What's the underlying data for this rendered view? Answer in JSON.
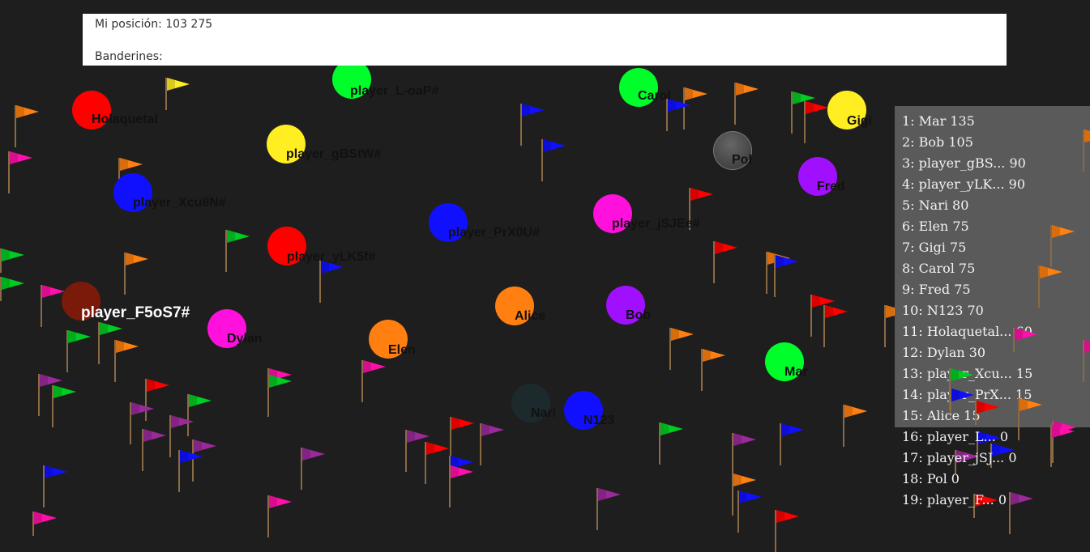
{
  "hud": {
    "position_label": "Mi posición:",
    "position_value": "103 275",
    "flags_label": "Banderines:"
  },
  "colors": {
    "background": "#1e1e1e",
    "hud": "#ffffff",
    "leaderboard": "#5a5a5a",
    "pole": "#8a6a45"
  },
  "players": [
    {
      "name": "Holaquetal",
      "color": "#ff0000"
    },
    {
      "name": "player_L-oaP#",
      "color": "#00ff2a"
    },
    {
      "name": "Carol",
      "color": "#00ff2a"
    },
    {
      "name": "Gigi",
      "color": "#ffee22"
    },
    {
      "name": "player_gBStW#",
      "color": "#ffee22"
    },
    {
      "name": "Pol",
      "color": "#555555"
    },
    {
      "name": "player_Xcu8N#",
      "color": "#1010ff"
    },
    {
      "name": "Fred",
      "color": "#a010ff"
    },
    {
      "name": "player_PrX0U#",
      "color": "#1010ff"
    },
    {
      "name": "player_jSJEe#",
      "color": "#ff10dd"
    },
    {
      "name": "player_yLK5f#",
      "color": "#ff0000"
    },
    {
      "name": "player_F5oS7#",
      "color": "#7a1a0a"
    },
    {
      "name": "Alice",
      "color": "#ff8010"
    },
    {
      "name": "Bob",
      "color": "#a010ff"
    },
    {
      "name": "Dylan",
      "color": "#ff10dd"
    },
    {
      "name": "Elen",
      "color": "#ff8010"
    },
    {
      "name": "Mar",
      "color": "#00ff2a"
    },
    {
      "name": "Nari",
      "color": "#1c2a2e"
    },
    {
      "name": "N123",
      "color": "#1010ff"
    }
  ],
  "leaderboard": [
    "1: Mar 135",
    "2: Bob 105",
    "3: player_gBS... 90",
    "4: player_yLK... 90",
    "5: Nari 80",
    "6: Elen 75",
    "7: Gigi 75",
    "8: Carol 75",
    "9: Fred 75",
    "10: N123 70",
    "11: Holaquetal... 60",
    "12: Dylan 30",
    "13: player_Xcu... 15",
    "14: player_PrX... 15",
    "15: Alice 15",
    "16: player_L... 0",
    "17: player_jSJ... 0",
    "18: Pol 0",
    "19: player_F... 0"
  ],
  "flags": [
    {
      "color": "#ff8010"
    },
    {
      "color": "#ff10aa"
    },
    {
      "color": "#ff8010"
    },
    {
      "color": "#ff8010"
    },
    {
      "color": "#ffee22"
    },
    {
      "color": "#1010ff"
    },
    {
      "color": "#1010ff"
    },
    {
      "color": "#ff8010"
    },
    {
      "color": "#ff8010"
    },
    {
      "color": "#1010ff"
    },
    {
      "color": "#00cc22"
    },
    {
      "color": "#ff0000"
    },
    {
      "color": "#ff0000"
    },
    {
      "color": "#00cc22"
    },
    {
      "color": "#ff8010"
    },
    {
      "color": "#ff0000"
    },
    {
      "color": "#1010ff"
    },
    {
      "color": "#ff8010"
    },
    {
      "color": "#ff0000"
    },
    {
      "color": "#00cc22"
    },
    {
      "color": "#ff10aa"
    },
    {
      "color": "#00cc22"
    },
    {
      "color": "#ff8010"
    },
    {
      "color": "#00cc22"
    },
    {
      "color": "#ff8010"
    },
    {
      "color": "#ff10aa"
    },
    {
      "color": "#ff8010"
    },
    {
      "color": "#ff8010"
    },
    {
      "color": "#1010ff"
    },
    {
      "color": "#ff0000"
    },
    {
      "color": "#ff8010"
    },
    {
      "color": "#ff10aa"
    },
    {
      "color": "#ff10aa"
    },
    {
      "color": "#00cc22"
    },
    {
      "color": "#ff0000"
    },
    {
      "color": "#00cc22"
    },
    {
      "color": "#00cc22"
    },
    {
      "color": "#9a2a9a"
    },
    {
      "color": "#00cc22"
    },
    {
      "color": "#9a2a9a"
    },
    {
      "color": "#9a2a9a"
    },
    {
      "color": "#9a2a9a"
    },
    {
      "color": "#9a2a9a"
    },
    {
      "color": "#1010ff"
    },
    {
      "color": "#9a2a9a"
    },
    {
      "color": "#9a2a9a"
    },
    {
      "color": "#ff0000"
    },
    {
      "color": "#ff0000"
    },
    {
      "color": "#9a2a9a"
    },
    {
      "color": "#1010ff"
    },
    {
      "color": "#ff10aa"
    },
    {
      "color": "#00cc22"
    },
    {
      "color": "#1010ff"
    },
    {
      "color": "#ff10aa"
    },
    {
      "color": "#00cc22"
    },
    {
      "color": "#9a2a9a"
    },
    {
      "color": "#ff8010"
    },
    {
      "color": "#ff0000"
    },
    {
      "color": "#9a2a9a"
    },
    {
      "color": "#1010ff"
    },
    {
      "color": "#ff8010"
    },
    {
      "color": "#ff10aa"
    },
    {
      "color": "#1010ff"
    },
    {
      "color": "#1010ff"
    },
    {
      "color": "#ff8010"
    },
    {
      "color": "#1010ff"
    },
    {
      "color": "#9a2a9a"
    },
    {
      "color": "#1010ff"
    },
    {
      "color": "#ff10aa"
    },
    {
      "color": "#ff0000"
    },
    {
      "color": "#9a2a9a"
    },
    {
      "color": "#ff8010"
    },
    {
      "color": "#ff0000"
    },
    {
      "color": "#ff8010"
    },
    {
      "color": "#ff10aa"
    },
    {
      "color": "#ff10aa"
    }
  ]
}
